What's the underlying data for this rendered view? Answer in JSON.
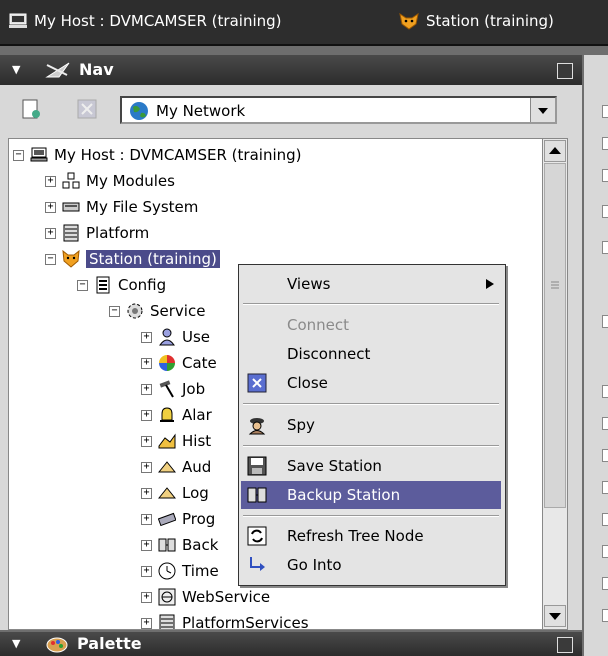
{
  "topbar": {
    "host_crumb": "My Host : DVMCAMSER (training)",
    "station_crumb": "Station (training)"
  },
  "nav": {
    "title": "Nav",
    "network_select": "My Network"
  },
  "palette": {
    "title": "Palette"
  },
  "tree": {
    "host": "My Host : DVMCAMSER (training)",
    "modules": "My Modules",
    "filesystem": "My File System",
    "platform": "Platform",
    "station": "Station (training)",
    "config": "Config",
    "services": "Service",
    "users": "Use",
    "categories": "Cate",
    "jobs": "Job",
    "alarms": "Alar",
    "history": "Hist",
    "audit": "Aud",
    "log": "Log",
    "programs": "Prog",
    "backup": "Back",
    "time": "Time",
    "webservice": "WebService",
    "platformservices": "PlatformServices"
  },
  "context_menu": {
    "views": "Views",
    "connect": "Connect",
    "disconnect": "Disconnect",
    "close": "Close",
    "spy": "Spy",
    "save_station": "Save Station",
    "backup_station": "Backup Station",
    "refresh": "Refresh Tree Node",
    "go_into": "Go Into"
  },
  "colors": {
    "selection": "#4b4b8a",
    "menu_highlight": "#5c5c9c",
    "titlebar": "#2d2d2d"
  }
}
